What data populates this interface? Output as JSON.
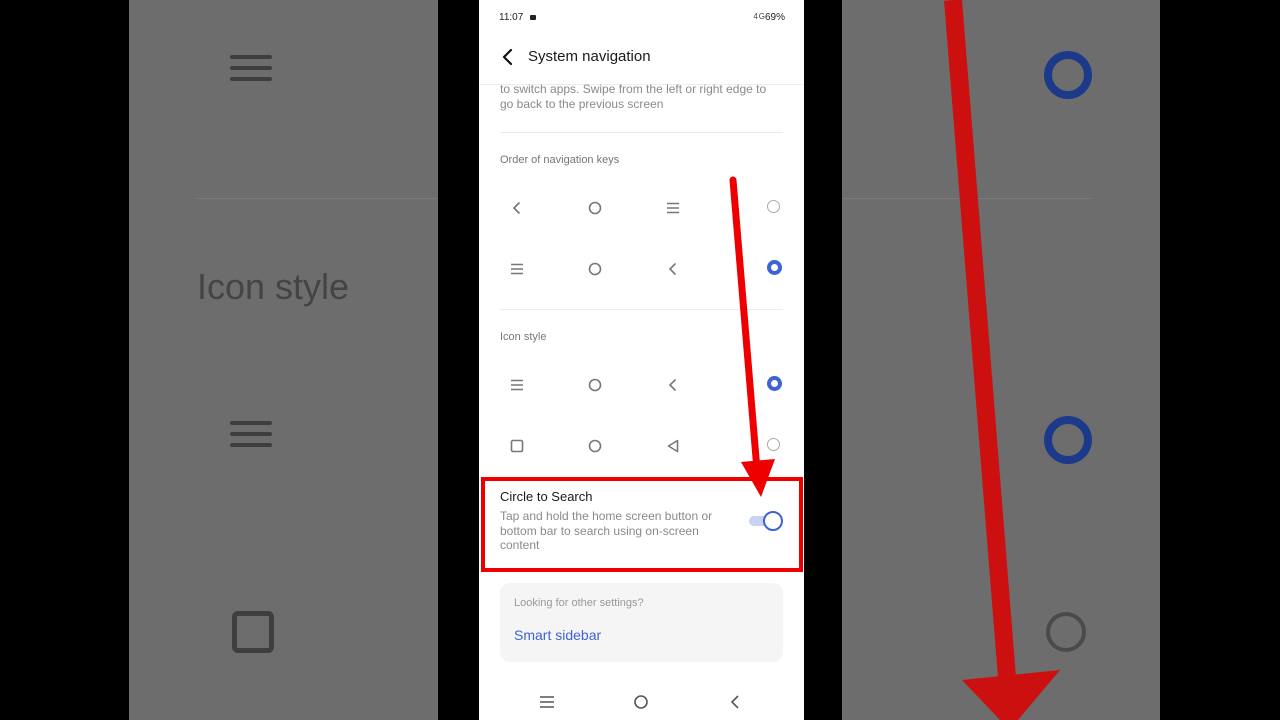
{
  "status_bar": {
    "time": "11:07",
    "indicators": "4G",
    "battery": "69%"
  },
  "header": {
    "title": "System navigation",
    "back_icon": "chevron-left-icon"
  },
  "description": "to switch apps. Swipe from the left or right edge to go back to the previous screen",
  "order_section": {
    "label": "Order of navigation keys",
    "options": [
      {
        "keys": [
          "back",
          "home",
          "menu"
        ],
        "selected": false
      },
      {
        "keys": [
          "menu",
          "home",
          "back"
        ],
        "selected": true
      }
    ]
  },
  "icon_style_section": {
    "label": "Icon style",
    "options": [
      {
        "keys": [
          "menu",
          "home",
          "back"
        ],
        "selected": true
      },
      {
        "keys": [
          "square",
          "home",
          "triangle"
        ],
        "selected": false
      }
    ]
  },
  "circle_to_search": {
    "title": "Circle to Search",
    "description": "Tap and hold the home screen button or bottom bar to search using on-screen content",
    "enabled": true
  },
  "other_settings": {
    "label": "Looking for other settings?",
    "link": "Smart sidebar"
  },
  "background_copy": {
    "title": "Icon style"
  },
  "colors": {
    "accent": "#3d63d6",
    "highlight": "#e00000"
  }
}
